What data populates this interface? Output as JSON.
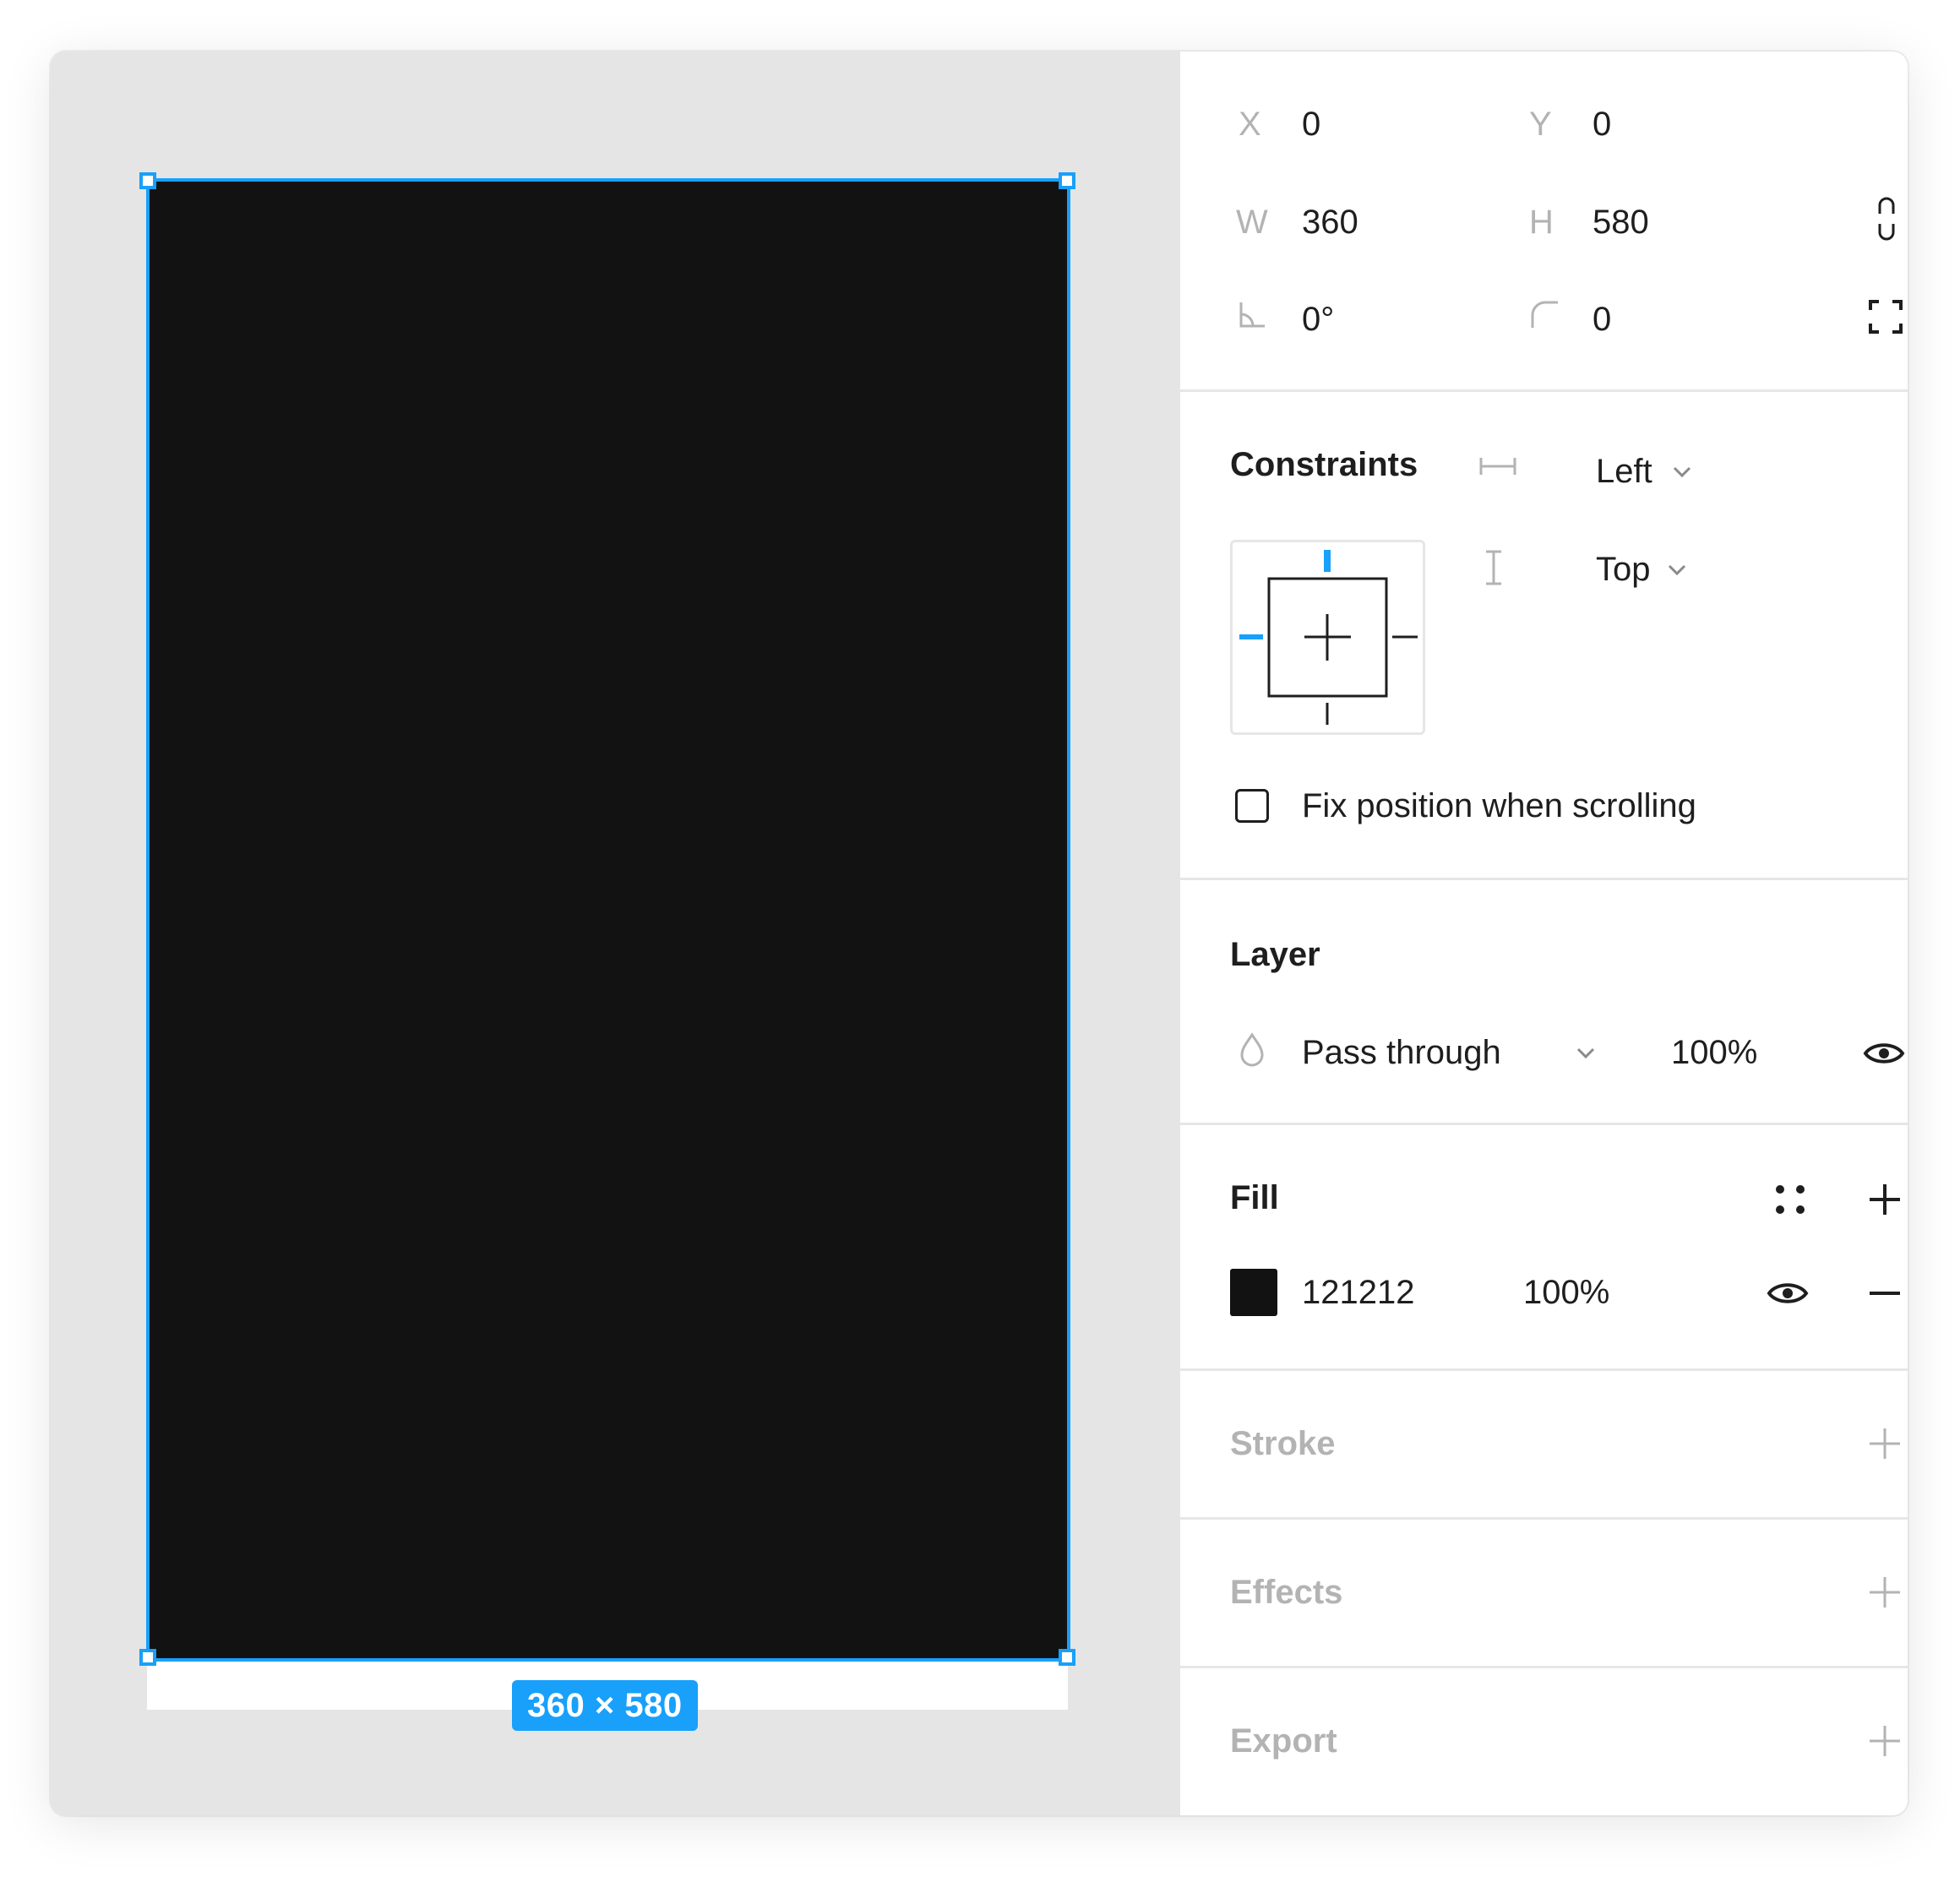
{
  "canvas": {
    "frame_fill": "#121212",
    "selection_color": "#18a0fb",
    "size_badge": "360 × 580"
  },
  "transform": {
    "x_label": "X",
    "x_value": "0",
    "y_label": "Y",
    "y_value": "0",
    "w_label": "W",
    "w_value": "360",
    "h_label": "H",
    "h_value": "580",
    "rotation_value": "0°",
    "corner_radius_value": "0"
  },
  "constraints": {
    "title": "Constraints",
    "horizontal": "Left",
    "vertical": "Top",
    "fix_position_label": "Fix position when scrolling",
    "fix_position_checked": false
  },
  "layer": {
    "title": "Layer",
    "blend_mode": "Pass through",
    "opacity": "100%"
  },
  "fill": {
    "title": "Fill",
    "hex": "121212",
    "opacity": "100%",
    "color": "#121212"
  },
  "stroke": {
    "title": "Stroke"
  },
  "effects": {
    "title": "Effects"
  },
  "export": {
    "title": "Export"
  }
}
